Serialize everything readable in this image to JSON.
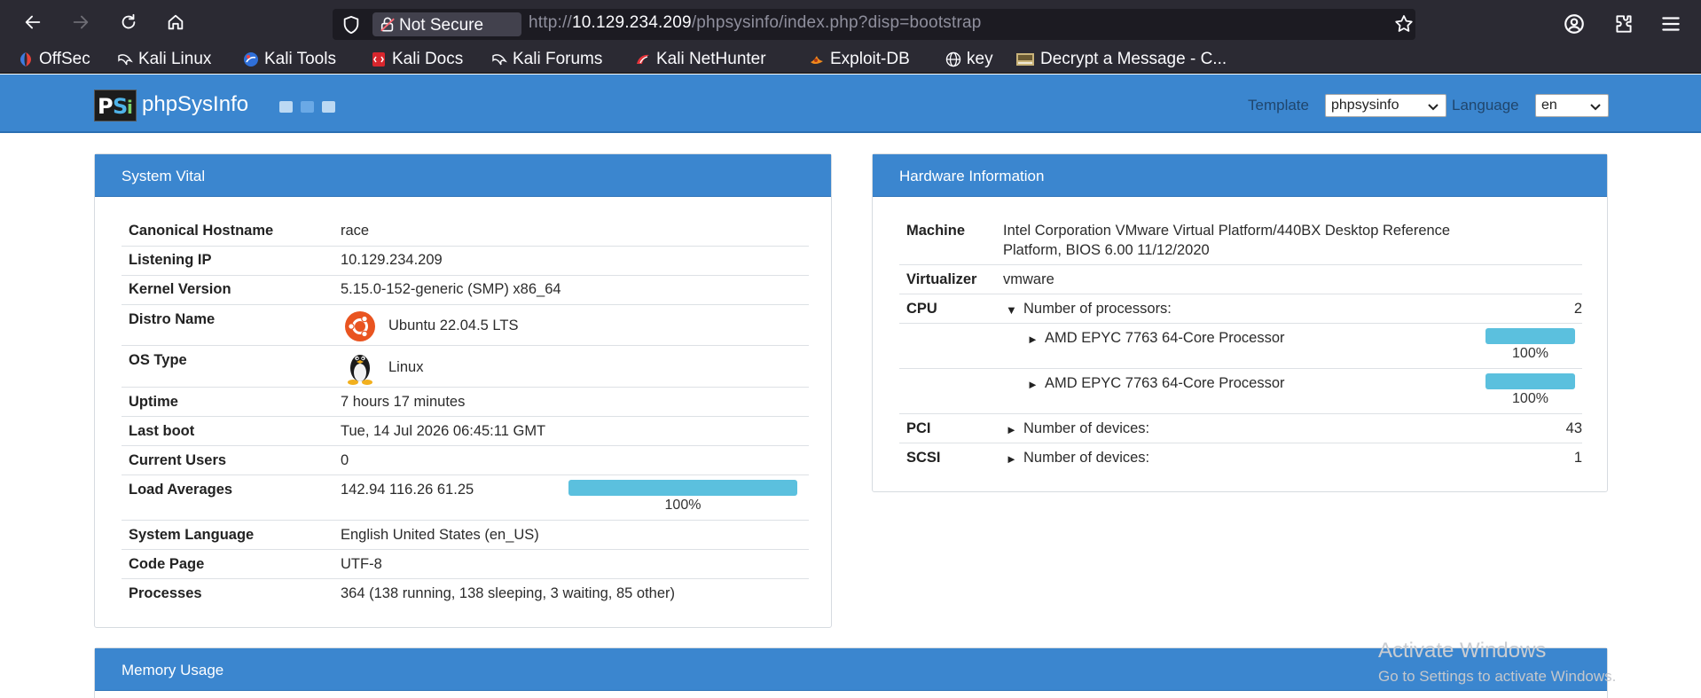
{
  "browser": {
    "not_secure_label": "Not Secure",
    "url_prefix": "http://",
    "url_host": "10.129.234.209",
    "url_path": "/phpsysinfo/index.php?disp=bootstrap",
    "bookmarks": [
      {
        "label": "OffSec",
        "icon": "offsec-icon"
      },
      {
        "label": "Kali Linux",
        "icon": "kali-dragon-icon"
      },
      {
        "label": "Kali Tools",
        "icon": "kali-tools-icon"
      },
      {
        "label": "Kali Docs",
        "icon": "kali-docs-icon"
      },
      {
        "label": "Kali Forums",
        "icon": "kali-dragon-icon"
      },
      {
        "label": "Kali NetHunter",
        "icon": "nethunter-icon"
      },
      {
        "label": "Exploit-DB",
        "icon": "exploit-db-icon"
      },
      {
        "label": "key",
        "icon": "globe-icon"
      },
      {
        "label": "Decrypt a Message - C...",
        "icon": "decrypt-icon"
      }
    ]
  },
  "header": {
    "logo_text_1": "P",
    "logo_text_2": "S",
    "logo_text_3": "i",
    "title": "phpSysInfo",
    "template_label": "Template",
    "template_value": "phpsysinfo",
    "language_label": "Language",
    "language_value": "en"
  },
  "system_vital": {
    "title": "System Vital",
    "rows": {
      "hostname": {
        "label": "Canonical Hostname",
        "value": "race"
      },
      "ip": {
        "label": "Listening IP",
        "value": "10.129.234.209"
      },
      "kernel": {
        "label": "Kernel Version",
        "value": "5.15.0-152-generic (SMP) x86_64"
      },
      "distro": {
        "label": "Distro Name",
        "value": "Ubuntu 22.04.5 LTS"
      },
      "ostype": {
        "label": "OS Type",
        "value": "Linux"
      },
      "uptime": {
        "label": "Uptime",
        "value": "7 hours 17 minutes"
      },
      "lastboot": {
        "label": "Last boot",
        "value": "Tue, 14 Jul 2026 06:45:11 GMT"
      },
      "users": {
        "label": "Current Users",
        "value": "0"
      },
      "load": {
        "label": "Load Averages",
        "value": "142.94 116.26 61.25",
        "percent_label": "100%",
        "percent": 100
      },
      "language": {
        "label": "System Language",
        "value": "English United States (en_US)"
      },
      "codepage": {
        "label": "Code Page",
        "value": "UTF-8"
      },
      "processes": {
        "label": "Processes",
        "value": "364 (138 running, 138 sleeping, 3 waiting, 85 other)"
      }
    }
  },
  "hardware": {
    "title": "Hardware Information",
    "machine_label": "Machine",
    "machine_line1": "Intel Corporation VMware Virtual Platform/440BX Desktop Reference",
    "machine_line2": "Platform, BIOS 6.00 11/12/2020",
    "virtualizer_label": "Virtualizer",
    "virtualizer_value": "vmware",
    "cpu_label": "CPU",
    "cpu_count_label": "Number of processors:",
    "cpu_count": "2",
    "processors": [
      {
        "name": "AMD EPYC 7763 64-Core Processor",
        "percent_label": "100%",
        "percent": 100
      },
      {
        "name": "AMD EPYC 7763 64-Core Processor",
        "percent_label": "100%",
        "percent": 100
      }
    ],
    "pci_label": "PCI",
    "pci_count_label": "Number of devices:",
    "pci_count": "43",
    "scsi_label": "SCSI",
    "scsi_count_label": "Number of devices:",
    "scsi_count": "1"
  },
  "memory": {
    "title": "Memory Usage"
  },
  "watermark": {
    "line1": "Activate Windows",
    "line2": "Go to Settings to activate Windows."
  },
  "colors": {
    "header_blue": "#3b86cf",
    "bar_cyan": "#5bc0de",
    "browser_chrome": "#2b2a33"
  }
}
